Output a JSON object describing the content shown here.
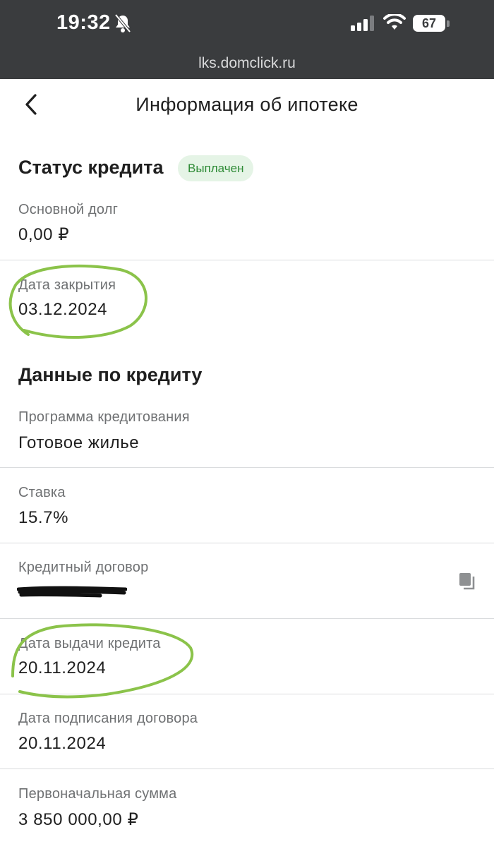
{
  "status_bar": {
    "time": "19:32",
    "battery": "67"
  },
  "browser": {
    "url": "lks.domclick.ru"
  },
  "nav": {
    "title": "Информация об ипотеке"
  },
  "credit_status": {
    "title": "Статус кредита",
    "badge": "Выплачен",
    "fields": [
      {
        "label": "Основной долг",
        "value": "0,00 ₽"
      },
      {
        "label": "Дата закрытия",
        "value": "03.12.2024"
      }
    ]
  },
  "credit_data": {
    "title": "Данные по кредиту",
    "fields": [
      {
        "label": "Программа кредитования",
        "value": "Готовое жилье"
      },
      {
        "label": "Ставка",
        "value": "15.7%"
      },
      {
        "label": "Кредитный договор",
        "value": ""
      },
      {
        "label": "Дата выдачи кредита",
        "value": "20.11.2024"
      },
      {
        "label": "Дата подписания договора",
        "value": "20.11.2024"
      },
      {
        "label": "Первоначальная сумма",
        "value": "3 850 000,00 ₽"
      }
    ]
  },
  "colors": {
    "accent_green": "#2e8b36",
    "badge_bg": "#e5f4e6",
    "marker_green": "#8bc34a",
    "status_bar_bg": "#3a3c3e"
  }
}
